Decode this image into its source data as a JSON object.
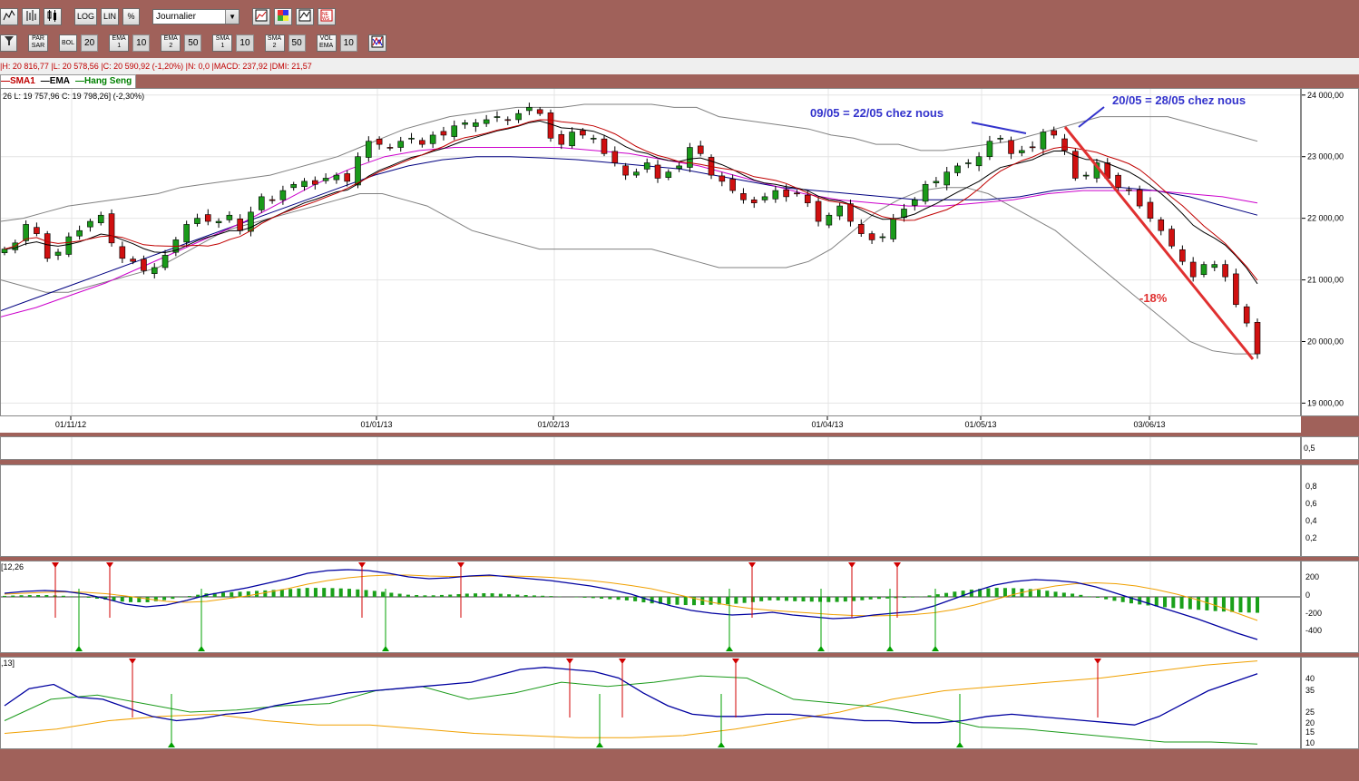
{
  "toolbar1": {
    "chart_buttons": [
      {
        "name": "line-chart-icon",
        "glyph": "╱╲"
      },
      {
        "name": "bar-chart-icon",
        "glyph": "┃┃"
      },
      {
        "name": "candlestick-icon",
        "glyph": "▯▮"
      }
    ],
    "scale_buttons": [
      "LOG",
      "LIN",
      "%"
    ],
    "period": "Journalier",
    "tool_icons": [
      "chart-settings-icon",
      "color-grid-icon",
      "compare-icon",
      "news-icon"
    ]
  },
  "toolbar2": {
    "items": [
      {
        "label": "PAR SAR",
        "value": ""
      },
      {
        "label": "BOL",
        "value": "20"
      },
      {
        "label": "EMA 1",
        "value": "10"
      },
      {
        "label": "EMA 2",
        "value": "50"
      },
      {
        "label": "SMA 1",
        "value": "10"
      },
      {
        "label": "SMA 2",
        "value": "50"
      },
      {
        "label": "VOL EMA",
        "value": "10"
      }
    ]
  },
  "info_line": "|H: 20 816,77 |L: 20 578,56 |C: 20 590,92 (-1,20%) |N: 0,0 |MACD: 237,92 |DMI: 21,57",
  "legend": [
    {
      "label": "SMA1",
      "color": "#c00000"
    },
    {
      "label": "EMA",
      "color": "#000000"
    },
    {
      "label": "Hang Seng",
      "color": "#008000"
    }
  ],
  "price_info": "26  L: 19 757,96  C: 19 798,26] (-2,30%)",
  "chart_data": {
    "type": "candlestick",
    "title": "Hang Seng",
    "ylim": [
      18800,
      24100
    ],
    "y_ticks": [
      "24 000,00",
      "23 000,00",
      "22 000,00",
      "21 000,00",
      "20 000,00",
      "19 000,00"
    ],
    "y_tick_values": [
      24000,
      23000,
      22000,
      21000,
      20000,
      19000
    ],
    "x_ticks": [
      "01/11/12",
      "01/01/13",
      "01/02/13",
      "01/04/13",
      "01/05/13",
      "03/06/13"
    ],
    "close": [
      21500,
      21600,
      21900,
      21750,
      21350,
      21450,
      21700,
      21800,
      21950,
      22050,
      21600,
      21350,
      21300,
      21150,
      21200,
      21400,
      21650,
      21900,
      22000,
      21950,
      21950,
      22050,
      21800,
      22100,
      22350,
      22300,
      22450,
      22550,
      22600,
      22550,
      22650,
      22700,
      22600,
      23000,
      23250,
      23200,
      23150,
      23250,
      23300,
      23200,
      23350,
      23350,
      23500,
      23550,
      23550,
      23600,
      23650,
      23600,
      23700,
      23800,
      23700,
      23300,
      23200,
      23400,
      23350,
      23300,
      23050,
      22900,
      22700,
      22750,
      22900,
      22650,
      22750,
      22850,
      23150,
      23050,
      22700,
      22600,
      22450,
      22300,
      22250,
      22350,
      22450,
      22350,
      22400,
      22250,
      21950,
      22050,
      22200,
      21950,
      21750,
      21650,
      21700,
      22000,
      22150,
      22300,
      22550,
      22600,
      22750,
      22850,
      22900,
      23000,
      23250,
      23300,
      23050,
      23100,
      23150,
      23400,
      23350,
      23100,
      22650,
      22700,
      22900,
      22650,
      22500,
      22450,
      22200,
      22000,
      21800,
      21550,
      21300,
      21050,
      21250,
      21250,
      21050,
      20600,
      20300,
      19800
    ],
    "overlays": {
      "bollinger": [
        {
          "name": "Bollinger upper",
          "color": "#808080",
          "values": [
            21950,
            22000,
            22100,
            22200,
            22250,
            22300,
            22350,
            22400,
            22500,
            22550,
            22600,
            22650,
            22700,
            22800,
            22900,
            23000,
            23150,
            23300,
            23450,
            23550,
            23650,
            23700,
            23750,
            23800,
            23800,
            23800,
            23850,
            23850,
            23850,
            23850,
            23800,
            23800,
            23650,
            23600,
            23550,
            23500,
            23450,
            23350,
            23300,
            23200,
            23200,
            23100,
            23100,
            23150,
            23200,
            23250,
            23350,
            23450,
            23550,
            23650,
            23650,
            23650,
            23650,
            23550,
            23450,
            23350,
            23250
          ]
        },
        {
          "name": "Bollinger lower",
          "color": "#808080",
          "values": [
            21000,
            20900,
            20800,
            20800,
            20900,
            21000,
            21100,
            21200,
            21400,
            21600,
            21800,
            21900,
            22000,
            22100,
            22200,
            22300,
            22400,
            22400,
            22300,
            22200,
            22000,
            21800,
            21700,
            21600,
            21500,
            21500,
            21500,
            21500,
            21500,
            21500,
            21400,
            21300,
            21200,
            21200,
            21200,
            21200,
            21300,
            21500,
            21800,
            22100,
            22300,
            22450,
            22500,
            22500,
            22400,
            22200,
            22000,
            21800,
            21500,
            21200,
            20900,
            20600,
            20300,
            20000,
            19850,
            19800,
            19800
          ]
        }
      ],
      "ema50": {
        "name": "EMA 50",
        "color": "#000080",
        "values": [
          20500,
          20700,
          20900,
          21100,
          21300,
          21500,
          21700,
          21900,
          22100,
          22300,
          22500,
          22700,
          22850,
          22950,
          23000,
          23000,
          22980,
          22950,
          22900,
          22850,
          22800,
          22700,
          22600,
          22500,
          22450,
          22400,
          22350,
          22300,
          22300,
          22300,
          22350,
          22450,
          22500,
          22500,
          22450,
          22350,
          22200,
          22050
        ]
      },
      "sma50": {
        "name": "SMA 50",
        "color": "#cc00cc",
        "values": [
          20400,
          20550,
          20750,
          20950,
          21200,
          21450,
          21700,
          21950,
          22250,
          22550,
          22800,
          23000,
          23100,
          23150,
          23150,
          23150,
          23150,
          23100,
          23050,
          22950,
          22850,
          22700,
          22550,
          22400,
          22300,
          22250,
          22200,
          22200,
          22250,
          22300,
          22400,
          22450,
          22450,
          22450,
          22400,
          22350,
          22250
        ]
      }
    }
  },
  "panel2_ticks": [
    "0,5"
  ],
  "panel3_ticks": [
    "0,8",
    "0,6",
    "0,4",
    "0,2"
  ],
  "macd_panel": {
    "label": "[12,26",
    "ticks": [
      "200",
      "0",
      "-200",
      "-400"
    ],
    "macd": [
      40,
      60,
      70,
      60,
      30,
      -20,
      -80,
      -110,
      -90,
      -40,
      20,
      60,
      100,
      150,
      200,
      260,
      290,
      300,
      290,
      260,
      220,
      200,
      210,
      230,
      240,
      220,
      200,
      180,
      150,
      120,
      80,
      30,
      -40,
      -100,
      -150,
      -180,
      -200,
      -190,
      -170,
      -200,
      -220,
      -240,
      -230,
      -200,
      -180,
      -160,
      -100,
      -20,
      60,
      130,
      170,
      190,
      180,
      160,
      110,
      40,
      -30,
      -100,
      -170,
      -240,
      -320,
      -400,
      -470
    ],
    "signal": [
      30,
      40,
      50,
      55,
      50,
      35,
      10,
      -20,
      -50,
      -60,
      -50,
      -20,
      10,
      50,
      90,
      140,
      180,
      210,
      230,
      240,
      240,
      230,
      225,
      225,
      230,
      230,
      225,
      215,
      200,
      180,
      155,
      125,
      90,
      40,
      -10,
      -60,
      -100,
      -130,
      -150,
      -165,
      -180,
      -195,
      -205,
      -210,
      -205,
      -195,
      -175,
      -140,
      -90,
      -30,
      30,
      80,
      120,
      145,
      155,
      145,
      120,
      80,
      30,
      -30,
      -100,
      -180,
      -260
    ]
  },
  "dmi_panel": {
    "label": ",13]",
    "ticks": [
      "40",
      "35",
      "25",
      "20",
      "15",
      "10"
    ],
    "adx": [
      27,
      35,
      37,
      31,
      30,
      26,
      22,
      20,
      21,
      23,
      24,
      27,
      29,
      31,
      33,
      34,
      35,
      36,
      37,
      38,
      41,
      44,
      45,
      44,
      43,
      40,
      33,
      27,
      23,
      22,
      22,
      23,
      23,
      22,
      21,
      20,
      20,
      19,
      19,
      20,
      22,
      23,
      22,
      21,
      20,
      19,
      18,
      22,
      28,
      34,
      38,
      42
    ],
    "plus_di": [
      20,
      30,
      32,
      28,
      24,
      25,
      27,
      28,
      34,
      36,
      30,
      33,
      38,
      36,
      38,
      41,
      40,
      30,
      28,
      26,
      22,
      17,
      16,
      14,
      12,
      10,
      10,
      9
    ],
    "minus_di": [
      14,
      16,
      20,
      22,
      23,
      20,
      18,
      18,
      16,
      14,
      13,
      12,
      12,
      13,
      16,
      20,
      24,
      30,
      34,
      36,
      38,
      40,
      43,
      46,
      48
    ]
  },
  "annotations": {
    "left_label": "09/05 = 22/05 chez nous",
    "right_label": "20/05 = 28/05 chez nous",
    "drop_label": "-18%",
    "annotation_color": "#3333cc",
    "drop_color": "#e03030"
  }
}
